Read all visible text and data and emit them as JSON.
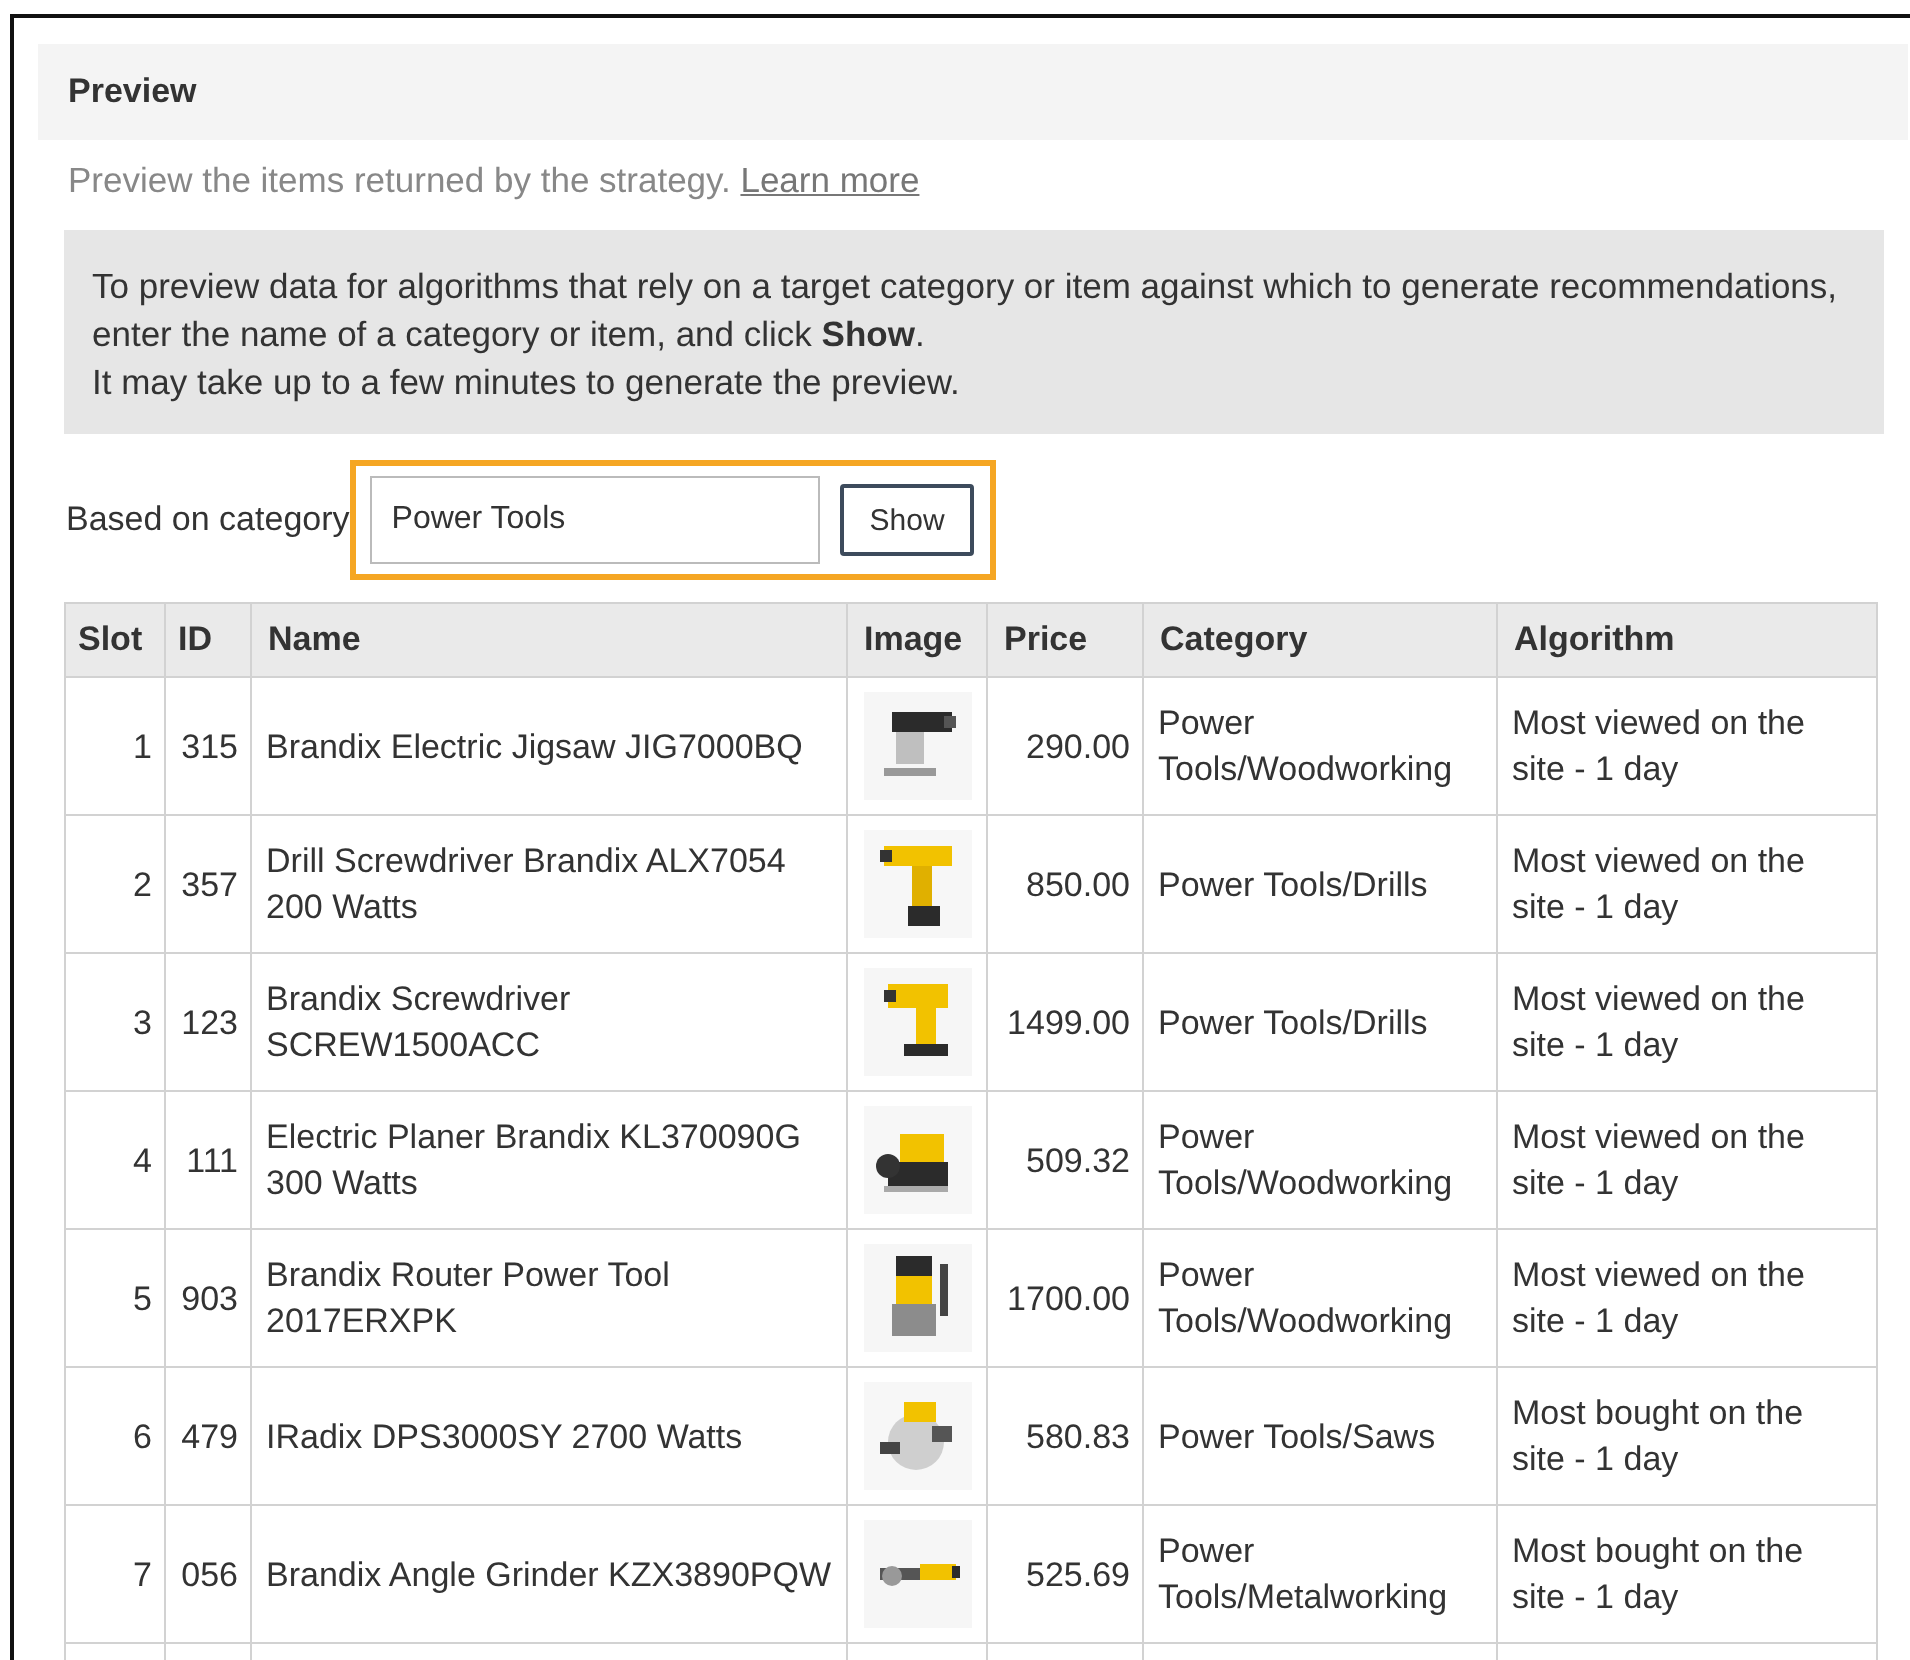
{
  "panel": {
    "title": "Preview",
    "description": "Preview the items returned by the strategy.",
    "link": "Learn more",
    "info": [
      "To preview data for algorithms that rely on a target category or item against which to generate recommendations, enter the name of a category or item, and click **Show**.",
      "It may take up to a few minutes to generate the preview."
    ],
    "form": {
      "label": "Based on category",
      "value": "Power Tools",
      "button": "Show",
      "highlighted": true
    }
  },
  "table": {
    "columns": [
      "Slot",
      "ID",
      "Name",
      "Image",
      "Price",
      "Category",
      "Algorithm"
    ],
    "rows": [
      {
        "slot": "1",
        "id": "315",
        "name": "Brandix Electric Jigsaw JIG7000BQ",
        "price": "290.00",
        "category": "Power Tools/Woodworking",
        "algorithm": "Most viewed on the site - 1 day"
      },
      {
        "slot": "2",
        "id": "357",
        "name": "Drill Screwdriver Brandix ALX7054 200 Watts",
        "price": "850.00",
        "category": "Power Tools/Drills",
        "algorithm": "Most viewed on the site - 1 day"
      },
      {
        "slot": "3",
        "id": "123",
        "name": "Brandix Screwdriver SCREW1500ACC",
        "price": "1499.00",
        "category": "Power Tools/Drills",
        "algorithm": "Most viewed on the site - 1 day"
      },
      {
        "slot": "4",
        "id": "111",
        "name": "Electric Planer Brandix KL370090G 300 Watts",
        "price": "509.32",
        "category": "Power Tools/Woodworking",
        "algorithm": "Most viewed on the site - 1 day"
      },
      {
        "slot": "5",
        "id": "903",
        "name": "Brandix Router Power Tool 2017ERXPK",
        "price": "1700.00",
        "category": "Power Tools/Woodworking",
        "algorithm": "Most viewed on the site - 1 day"
      },
      {
        "slot": "6",
        "id": "479",
        "name": "IRadix DPS3000SY 2700 Watts",
        "price": "580.83",
        "category": "Power Tools/Saws",
        "algorithm": "Most bought on the site - 1 day"
      },
      {
        "slot": "7",
        "id": "056",
        "name": "Brandix Angle Grinder KZX3890PQW",
        "price": "525.69",
        "category": "Power Tools/Metalworking",
        "algorithm": "Most bought on the site - 1 day"
      }
    ]
  }
}
